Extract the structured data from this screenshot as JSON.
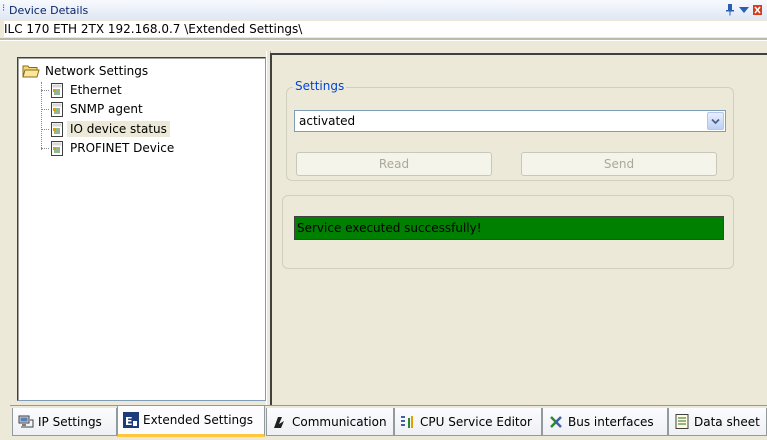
{
  "window": {
    "title": "Device Details"
  },
  "path": "ILC 170 ETH 2TX 192.168.0.7 \\Extended Settings\\",
  "tree": {
    "root_label": "Network Settings",
    "items": [
      {
        "label": "Ethernet",
        "icon": "document-icon"
      },
      {
        "label": "SNMP agent",
        "icon": "document-icon"
      },
      {
        "label": "IO device status",
        "icon": "document-icon",
        "selected": true
      },
      {
        "label": "PROFINET Device",
        "icon": "document-icon"
      }
    ]
  },
  "settings": {
    "legend": "Settings",
    "selected_value": "activated",
    "read_label": "Read",
    "send_label": "Send"
  },
  "status": {
    "message": "Service executed successfully!",
    "color": "#008000"
  },
  "tabs": [
    {
      "label": "IP Settings",
      "icon": "network-icon"
    },
    {
      "label": "Extended Settings",
      "icon": "extended-settings-icon",
      "active": true
    },
    {
      "label": "Communication",
      "icon": "communication-icon"
    },
    {
      "label": "CPU Service Editor",
      "icon": "cpu-editor-icon"
    },
    {
      "label": "Bus interfaces",
      "icon": "bus-interfaces-icon"
    },
    {
      "label": "Data sheet",
      "icon": "data-sheet-icon"
    }
  ],
  "colors": {
    "accent": "#0046d5",
    "status_ok": "#008000",
    "active_tab_highlight": "#ffc83c"
  }
}
